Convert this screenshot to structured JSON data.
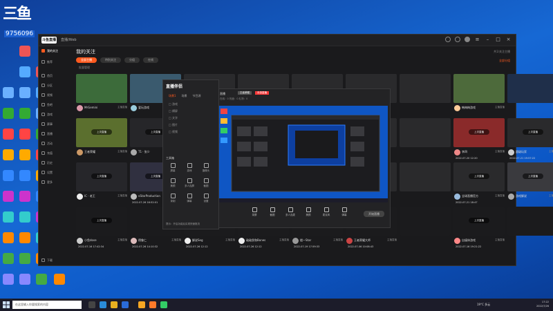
{
  "overlay": {
    "logo": "三鱼",
    "number": "9756096"
  },
  "window": {
    "brand": "斗鱼直播",
    "url": "直播/Web"
  },
  "sidebar": {
    "items": [
      {
        "label": "我的关注"
      },
      {
        "label": "推荐"
      },
      {
        "label": "首页"
      },
      {
        "label": "分区"
      },
      {
        "label": "视频"
      },
      {
        "label": "鱼吧"
      },
      {
        "label": "游戏"
      },
      {
        "label": "赛事"
      },
      {
        "label": "直播"
      },
      {
        "label": "活动"
      },
      {
        "label": "充值"
      },
      {
        "label": "历史"
      },
      {
        "label": "设置"
      },
      {
        "label": "更多"
      }
    ],
    "footer": "下载"
  },
  "main": {
    "title": "我的关注",
    "filters": [
      {
        "label": "全部主播",
        "active": true
      },
      {
        "label": "特别关注",
        "active": false
      },
      {
        "label": "分组",
        "active": false
      },
      {
        "label": "在线",
        "active": false
      }
    ],
    "sub_hint": "批量管理",
    "right_hint_top": "共1/关注主播",
    "right_hint": "全部分组"
  },
  "cards": [
    {
      "name": "MrGemini",
      "stat": "主播直播",
      "replay": "",
      "date": "",
      "bg": "#3c6b3a",
      "av": "#d9a"
    },
    {
      "name": "爱玩游戏",
      "stat": "主播直播",
      "replay": "",
      "date": "",
      "bg": "#3a5a6e",
      "av": "#9cd"
    },
    {
      "name": "",
      "stat": "",
      "replay": "",
      "date": "",
      "bg": "#2a2a2c",
      "av": "#555"
    },
    {
      "name": "",
      "stat": "",
      "replay": "",
      "date": "",
      "bg": "#2a2a2c",
      "av": "#555"
    },
    {
      "name": "",
      "stat": "",
      "replay": "",
      "date": "",
      "bg": "#2a2a2c",
      "av": "#555"
    },
    {
      "name": "",
      "stat": "",
      "replay": "",
      "date": "",
      "bg": "#2a2a2c",
      "av": "#555"
    },
    {
      "name": "",
      "stat": "",
      "replay": "",
      "date": "",
      "bg": "#2a2a2c",
      "av": "#555"
    },
    {
      "name": "韩梅梅游戏",
      "stat": "主播直播",
      "replay": "",
      "date": "",
      "bg": "#4d6a3b",
      "av": "#fc9"
    },
    {
      "name": "",
      "stat": "",
      "replay": "",
      "date": "",
      "bg": "#1f2f4a",
      "av": "#9ad"
    },
    {
      "name": "王者荣耀",
      "stat": "主播直播",
      "replay": "上次直播",
      "date": "",
      "bg": "#5b6f2e",
      "av": "#c96"
    },
    {
      "name": "T1 · 张少",
      "stat": "主播直播",
      "replay": "上次直播",
      "date": "",
      "bg": "#262629",
      "av": "#aaa"
    },
    {
      "name": "",
      "stat": "",
      "replay": "",
      "date": "",
      "bg": "#2a2a2c",
      "av": "#555"
    },
    {
      "name": "",
      "stat": "",
      "replay": "",
      "date": "",
      "bg": "#2a2a2c",
      "av": "#555"
    },
    {
      "name": "",
      "stat": "",
      "replay": "",
      "date": "",
      "bg": "#2a2a2c",
      "av": "#555"
    },
    {
      "name": "",
      "stat": "",
      "replay": "",
      "date": "",
      "bg": "#2a2a2c",
      "av": "#555"
    },
    {
      "name": "",
      "stat": "",
      "replay": "",
      "date": "",
      "bg": "#2a2a2c",
      "av": "#555"
    },
    {
      "name": "李四",
      "stat": "主播直播",
      "replay": "上次直播",
      "date": "2022-07-20 12:20",
      "bg": "#8a2a2a",
      "av": "#e88"
    },
    {
      "name": "超级玩家",
      "stat": "主播直播",
      "replay": "上次直播",
      "date": "2022-07-21 19:57:22",
      "bg": "#2a2a2c",
      "av": "#ccc"
    },
    {
      "name": "IC · 老王",
      "stat": "主播直播",
      "replay": "上次直播",
      "date": "",
      "bg": "#26262a",
      "av": "#eee"
    },
    {
      "name": "vStarProduction",
      "stat": "主播直播",
      "replay": "上次直播",
      "date": "2022-07-26 16:52:01",
      "bg": "#303040",
      "av": "#bbb"
    },
    {
      "name": "",
      "stat": "",
      "replay": "",
      "date": "",
      "bg": "#2a2a2c",
      "av": "#555"
    },
    {
      "name": "",
      "stat": "",
      "replay": "",
      "date": "",
      "bg": "#2a2a2c",
      "av": "#555"
    },
    {
      "name": "",
      "stat": "",
      "replay": "",
      "date": "",
      "bg": "#2a2a2c",
      "av": "#555"
    },
    {
      "name": "",
      "stat": "",
      "replay": "",
      "date": "",
      "bg": "#2a2a2c",
      "av": "#555"
    },
    {
      "name": "",
      "stat": "",
      "replay": "",
      "date": "",
      "bg": "#2a2a2c",
      "av": "#555"
    },
    {
      "name": "全球直播官方",
      "stat": "主播直播",
      "replay": "上次直播",
      "date": "2022-07-21 18:47",
      "bg": "#2a2a2c",
      "av": "#9bd"
    },
    {
      "name": "游戏解说",
      "stat": "主播直播",
      "replay": "上次直播",
      "date": "",
      "bg": "#3a3a3e",
      "av": "#aaa"
    },
    {
      "name": "小鱼dose",
      "stat": "主播直播",
      "replay": "上次直播",
      "date": "2022-07-16 17:42:34",
      "bg": "#1b1b1d",
      "av": "#ccc"
    },
    {
      "name": "德鲁仁",
      "stat": "主播直播",
      "replay": "",
      "date": "2022-07-26 14:10:32",
      "bg": "#1b1b1d",
      "av": "#dbb"
    },
    {
      "name": "解说Seg",
      "stat": "主播直播",
      "replay": "上次直播",
      "date": "2022-07-26 12:12",
      "bg": "#1b1b1d",
      "av": "#eee"
    },
    {
      "name": "敌敌畏和Bones",
      "stat": "主播直播",
      "replay": "上次直播",
      "date": "2022-07-26 12:12",
      "bg": "#1b1b1d",
      "av": "#eee"
    },
    {
      "name": "楼一Star",
      "stat": "主播直播",
      "replay": "上次直播",
      "date": "2022-07-19 17:59:33",
      "bg": "#1b1b1d",
      "av": "#999"
    },
    {
      "name": "王者荣耀大师",
      "stat": "主播直播",
      "replay": "上次直播",
      "date": "2022-07-06 10:08:43",
      "bg": "#1b1b1d",
      "av": "#c44"
    },
    {
      "name": "",
      "stat": "",
      "replay": "",
      "date": "",
      "bg": "#1b1b1d",
      "av": "#555"
    },
    {
      "name": "自媒体游戏",
      "stat": "主播直播",
      "replay": "上次直播",
      "date": "2022-07-16 19:21:22",
      "bg": "#1b1b1d",
      "av": "#f88"
    },
    {
      "name": "",
      "stat": "",
      "replay": "",
      "date": "",
      "bg": "#1b1b1d",
      "av": "#555"
    }
  ],
  "tool": {
    "logo": "直播伴侣",
    "tabs": [
      {
        "label": "场景1",
        "on": true
      },
      {
        "label": "场景",
        "on": false
      },
      {
        "label": "节目源",
        "on": false
      }
    ],
    "scenes": [
      "□ 游戏",
      "□ 横屏",
      "□ 文字",
      "□ 图片",
      "□ 视频"
    ],
    "section": "工具箱",
    "buttons": [
      "屏幕",
      "游戏",
      "摄像头",
      "美颜",
      "多人连屏",
      "截图",
      "录制",
      "弹幕",
      "设置"
    ],
    "tip": "提示：开启功能后实现快速推流"
  },
  "preview": {
    "title": "直播",
    "tag": "王者荣耀",
    "badge": "手游直播",
    "meta": "在线：0   热度：0   礼物：0",
    "buttons": [
      "录屏",
      "截图",
      "多人连麦",
      "美颜",
      "麦克风",
      "弹幕"
    ],
    "start": "开始直播"
  },
  "taskbar": {
    "search": "在这里输入你要搜索的内容",
    "weather": "19°C 多云",
    "time": "17:22",
    "date": "2022/7/26"
  },
  "colors": {
    "accent": "#ff5a1f",
    "desktop": "#1668d4"
  }
}
